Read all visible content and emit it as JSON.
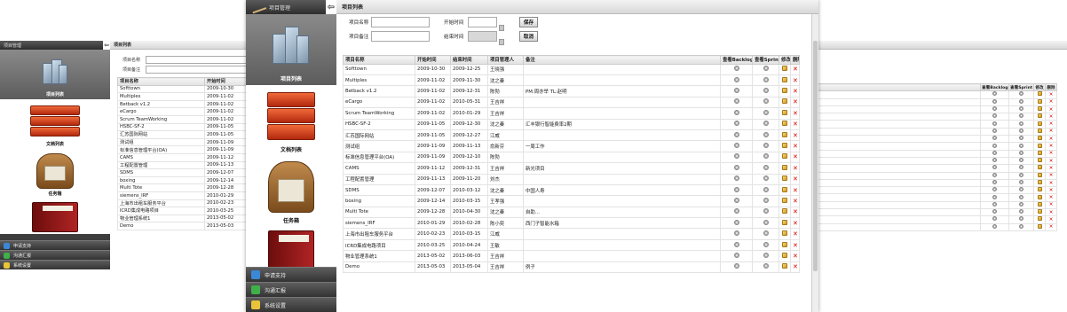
{
  "app": {
    "side_title": "项目管理",
    "back_glyph": "⇦",
    "modules": [
      {
        "label": "项目列表",
        "icon": "project-cubes-icon"
      },
      {
        "label": "文档列表",
        "icon": "document-books-icon"
      },
      {
        "label": "任务箱",
        "icon": "task-bag-icon"
      },
      {
        "label": "",
        "icon": "red-book-icon"
      }
    ],
    "bottom_nav": [
      {
        "label": "申请支持",
        "icon": "support-icon",
        "color": "#3b88d8"
      },
      {
        "label": "沟通汇报",
        "icon": "report-icon",
        "color": "#3fb04a"
      },
      {
        "label": "系统设置",
        "icon": "settings-icon",
        "color": "#e8c43a"
      }
    ]
  },
  "panel": {
    "title": "项目列表",
    "form": {
      "name_label": "项目名称",
      "note_label": "项目备注",
      "start_label": "开始时间",
      "end_label": "结束时间",
      "save": "保存",
      "cancel": "取消"
    }
  },
  "table": {
    "columns": [
      "项目名称",
      "开始时间",
      "结束时间",
      "项目管理人",
      "备注",
      "查看Backlog",
      "查看Sprint",
      "修改",
      "删除"
    ],
    "rows": [
      [
        "Softtown",
        "2009-10-30",
        "2009-12-25",
        "王晓强",
        ""
      ],
      [
        "Multiples",
        "2009-11-02",
        "2009-11-30",
        "沈之秦",
        ""
      ],
      [
        "Betback v1.2",
        "2009-11-02",
        "2009-12-31",
        "陈勃",
        "PM:周亦举 TL:赵明"
      ],
      [
        "eCargo",
        "2009-11-02",
        "2010-05-31",
        "王吉祥",
        ""
      ],
      [
        "Scrum TeamWorking",
        "2009-11-02",
        "2010-01-29",
        "王吉祥",
        ""
      ],
      [
        "HSBC-SF-2",
        "2009-11-05",
        "2009-12-30",
        "沈之秦",
        "汇丰银行智能费率2期"
      ],
      [
        "汇苏国际网站",
        "2009-11-05",
        "2009-12-27",
        "江威",
        ""
      ],
      [
        "测试组",
        "2009-11-09",
        "2009-11-13",
        "俞新芬",
        "一周工作"
      ],
      [
        "标准信息管理平台(OA)",
        "2009-11-09",
        "2009-12-10",
        "陈勃",
        ""
      ],
      [
        "CAMS",
        "2009-11-12",
        "2009-12-31",
        "王吉祥",
        "新光项目"
      ],
      [
        "工程配置管理",
        "2009-11-13",
        "2009-11-20",
        "刘杰",
        ""
      ],
      [
        "SDMS",
        "2009-12-07",
        "2010-03-12",
        "沈之秦",
        "中国人寿"
      ],
      [
        "boxing",
        "2009-12-14",
        "2010-03-15",
        "王孝强",
        ""
      ],
      [
        "Multi Tote",
        "2009-12-28",
        "2010-04-30",
        "沈之秦",
        "自助..."
      ],
      [
        "siemens_IRF",
        "2010-01-29",
        "2010-02-28",
        "陈小奕",
        "西门子智能水箱"
      ],
      [
        "上海市出租车服务平台",
        "2010-02-23",
        "2010-03-15",
        "江威",
        ""
      ],
      [
        "ICRD集成电路项目",
        "2010-03-25",
        "2010-04-24",
        "王敏",
        ""
      ],
      [
        "物业管理系统1",
        "2013-05-02",
        "2013-06-03",
        "王吉祥",
        ""
      ],
      [
        "Demo",
        "2013-05-03",
        "2013-05-04",
        "王吉祥",
        "例子"
      ]
    ]
  },
  "colors": {
    "sidebar_bg": "#3d3d3d",
    "delete_red": "#d40000"
  }
}
